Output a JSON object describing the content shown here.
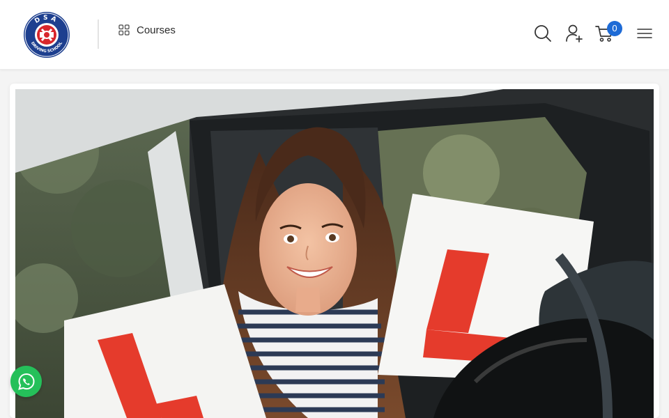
{
  "brand": {
    "logo_top_text": "DSA",
    "logo_ring_text": "DRIVING SCHOOL",
    "logo_colors": {
      "ring": "#1d3f8f",
      "center": "#d8262c"
    }
  },
  "nav": {
    "courses_label": "Courses",
    "courses_icon": "grid-icon"
  },
  "header_actions": {
    "search_icon": "search-icon",
    "account_icon": "user-plus-icon",
    "cart_icon": "cart-icon",
    "cart_count": "0",
    "menu_icon": "hamburger-icon"
  },
  "hero": {
    "image": "smiling learner driver holding L plates in car window",
    "plate_color": "#e53b2c"
  },
  "chat": {
    "icon": "whatsapp-icon",
    "color": "#25c05a"
  },
  "colors": {
    "accent": "#1e6bd6",
    "text": "#2b2b2b"
  }
}
